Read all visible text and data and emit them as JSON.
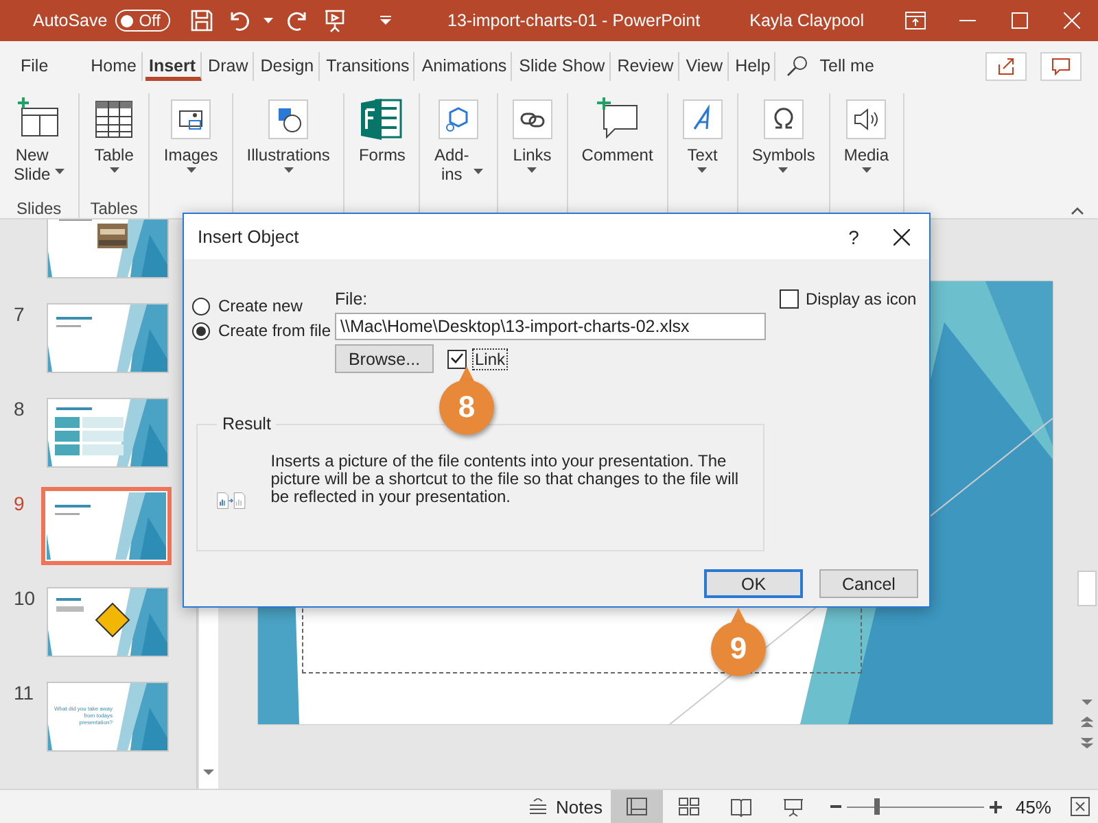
{
  "title_bar": {
    "autosave_label": "AutoSave",
    "autosave_toggle": {
      "label": "Off",
      "on": false
    },
    "document_title": "13-import-charts-01  -  PowerPoint",
    "user": "Kayla Claypool"
  },
  "tabs": [
    {
      "label": "File",
      "selected": false
    },
    {
      "label": "Home",
      "selected": false
    },
    {
      "label": "Insert",
      "selected": true
    },
    {
      "label": "Draw",
      "selected": false
    },
    {
      "label": "Design",
      "selected": false
    },
    {
      "label": "Transitions",
      "selected": false
    },
    {
      "label": "Animations",
      "selected": false
    },
    {
      "label": "Slide Show",
      "selected": false
    },
    {
      "label": "Review",
      "selected": false
    },
    {
      "label": "View",
      "selected": false
    },
    {
      "label": "Help",
      "selected": false
    }
  ],
  "search": {
    "label": "Tell me"
  },
  "ribbon": {
    "groups": [
      {
        "label": "Slides",
        "buttons": [
          {
            "kind": "new-slide",
            "label": "New Slide",
            "caret": true
          }
        ]
      },
      {
        "label": "Tables",
        "buttons": [
          {
            "kind": "table",
            "label": "Table",
            "caret": true
          }
        ]
      },
      {
        "buttons": [
          {
            "kind": "images",
            "label": "Images",
            "caret": true
          }
        ]
      },
      {
        "buttons": [
          {
            "kind": "shapes",
            "label": "Illustrations",
            "caret": true
          }
        ]
      },
      {
        "buttons": [
          {
            "kind": "forms",
            "label": "Forms",
            "caret": false
          }
        ]
      },
      {
        "buttons": [
          {
            "kind": "addins",
            "label": "Add-ins",
            "caret": true
          }
        ]
      },
      {
        "buttons": [
          {
            "kind": "link",
            "label": "Links",
            "caret": true
          }
        ]
      },
      {
        "buttons": [
          {
            "kind": "comment",
            "label": "Comment",
            "caret": false
          }
        ]
      },
      {
        "buttons": [
          {
            "kind": "text",
            "label": "Text",
            "caret": true
          }
        ]
      },
      {
        "buttons": [
          {
            "kind": "omega",
            "label": "Symbols",
            "caret": true
          }
        ]
      },
      {
        "buttons": [
          {
            "kind": "speaker",
            "label": "Media",
            "caret": true
          }
        ]
      }
    ]
  },
  "slides": [
    {
      "kind": "books",
      "selected": false
    },
    {
      "number": "7",
      "kind": "title",
      "selected": false
    },
    {
      "number": "8",
      "kind": "list",
      "selected": false
    },
    {
      "number": "9",
      "kind": "title",
      "selected": true
    },
    {
      "number": "10",
      "kind": "sign",
      "selected": false
    },
    {
      "number": "11",
      "kind": "closing",
      "selected": false,
      "text": "What did you take away from todays presentation?"
    }
  ],
  "dialog": {
    "title": "Insert Object",
    "help": "?",
    "options": [
      {
        "label": "Create new",
        "selected": false
      },
      {
        "label": "Create from file",
        "selected": true
      }
    ],
    "file_label": "File:",
    "file_value": "\\\\Mac\\Home\\Desktop\\13-import-charts-02.xlsx",
    "browse": "Browse...",
    "link": {
      "label": "Link",
      "checked": true
    },
    "display_as_icon": {
      "label": "Display as icon",
      "checked": false
    },
    "result": {
      "label": "Result",
      "text": "Inserts a picture of the file contents into your presentation. The picture will be a shortcut to the file so that changes to the file will be reflected in your presentation."
    },
    "buttons": [
      {
        "label": "OK",
        "default": true
      },
      {
        "label": "Cancel",
        "default": false
      }
    ]
  },
  "callouts": [
    {
      "number": "8"
    },
    {
      "number": "9"
    }
  ],
  "status_bar": {
    "notes": "Notes",
    "views": [
      {
        "kind": "normal",
        "selected": true
      },
      {
        "kind": "sorter",
        "selected": false
      },
      {
        "kind": "reading",
        "selected": false
      },
      {
        "kind": "slideshow",
        "selected": false
      }
    ],
    "zoom": {
      "level": 0.22,
      "reading": "45%"
    }
  }
}
